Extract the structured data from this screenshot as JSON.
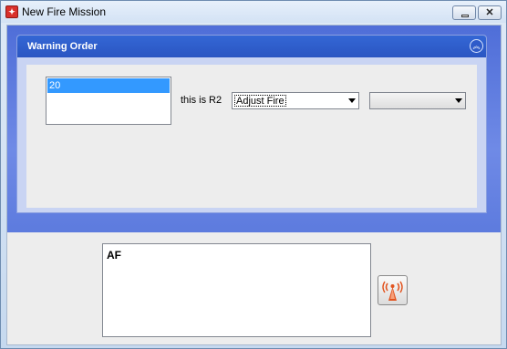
{
  "window": {
    "title": "New Fire Mission"
  },
  "warning_order": {
    "header": "Warning Order",
    "list_items": [
      "20"
    ],
    "selected_index": 0,
    "this_is_label": "this is",
    "unit_id": "R2",
    "mission_type": "Adjust Fire",
    "second_select": ""
  },
  "message": {
    "text": "AF"
  },
  "icons": {
    "app": "fire-mission-app-icon",
    "radio": "radio-tower-icon",
    "collapse": "chevron-up-icon"
  },
  "colors": {
    "header_blue": "#2a55c2",
    "selection_blue": "#3399ff",
    "radio_orange": "#e2531e"
  }
}
